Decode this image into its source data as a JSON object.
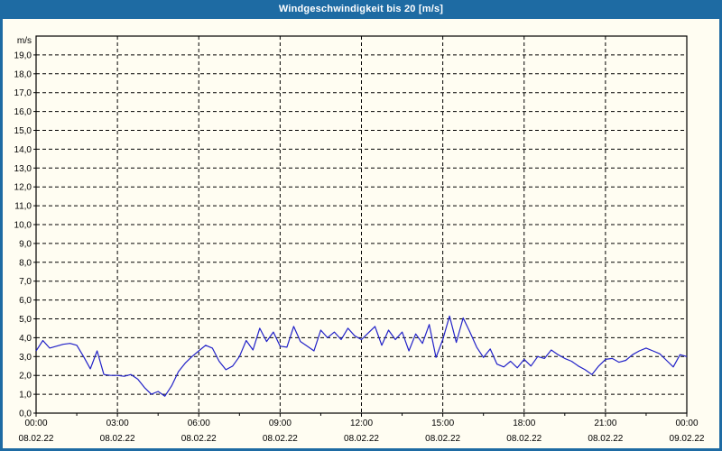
{
  "window": {
    "title": "Windgeschwindigkeit bis 20 [m/s]"
  },
  "colors": {
    "titlebar_bg": "#1e6ba3",
    "frame_border": "#1e6ba3",
    "content_bg": "#fffdf2",
    "plot_bg": "#fffdf2",
    "grid": "#000000",
    "axis": "#000000",
    "tick_text": "#000000",
    "title_text": "#ffffff",
    "line": "#2121c8"
  },
  "chart_data": {
    "type": "line",
    "title": "Windgeschwindigkeit bis 20 [m/s]",
    "xlabel": "",
    "ylabel": "m/s",
    "ylim": [
      0,
      20
    ],
    "y_tick_step": 1.0,
    "y_tick_labels": [
      "0,0",
      "1,0",
      "2,0",
      "3,0",
      "4,0",
      "5,0",
      "6,0",
      "7,0",
      "8,0",
      "9,0",
      "10,0",
      "11,0",
      "12,0",
      "13,0",
      "14,0",
      "15,0",
      "16,0",
      "17,0",
      "18,0",
      "19,0"
    ],
    "x_range_hours": [
      0,
      24
    ],
    "x_step_hours": 0.25,
    "x_major_ticks": [
      {
        "hour": 0,
        "time": "00:00",
        "date": "08.02.22"
      },
      {
        "hour": 3,
        "time": "03:00",
        "date": "08.02.22"
      },
      {
        "hour": 6,
        "time": "06:00",
        "date": "08.02.22"
      },
      {
        "hour": 9,
        "time": "09:00",
        "date": "08.02.22"
      },
      {
        "hour": 12,
        "time": "12:00",
        "date": "08.02.22"
      },
      {
        "hour": 15,
        "time": "15:00",
        "date": "08.02.22"
      },
      {
        "hour": 18,
        "time": "18:00",
        "date": "08.02.22"
      },
      {
        "hour": 21,
        "time": "21:00",
        "date": "08.02.22"
      },
      {
        "hour": 24,
        "time": "00:00",
        "date": "09.02.22"
      }
    ],
    "x_minor_tick_hours": [
      1.5,
      4.5,
      7.5,
      10.5,
      13.5,
      16.5,
      19.5,
      22.5
    ],
    "grid": "dashed",
    "legend": "none",
    "series": [
      {
        "name": "Windgeschwindigkeit",
        "unit": "m/s",
        "values": [
          3.3,
          3.85,
          3.45,
          3.55,
          3.65,
          3.7,
          3.6,
          3.0,
          2.35,
          3.3,
          2.05,
          2.0,
          2.0,
          1.95,
          2.05,
          1.8,
          1.35,
          1.0,
          1.15,
          0.9,
          1.45,
          2.2,
          2.65,
          3.0,
          3.3,
          3.6,
          3.45,
          2.75,
          2.3,
          2.5,
          3.0,
          3.85,
          3.35,
          4.5,
          3.8,
          4.3,
          3.55,
          3.5,
          4.6,
          3.8,
          3.55,
          3.3,
          4.4,
          4.0,
          4.3,
          3.9,
          4.5,
          4.1,
          3.9,
          4.25,
          4.6,
          3.6,
          4.4,
          3.9,
          4.3,
          3.3,
          4.2,
          3.7,
          4.7,
          2.95,
          3.9,
          5.15,
          3.75,
          5.05,
          4.3,
          3.5,
          2.95,
          3.4,
          2.6,
          2.45,
          2.75,
          2.4,
          2.85,
          2.5,
          3.0,
          2.9,
          3.35,
          3.1,
          2.9,
          2.75,
          2.5,
          2.3,
          2.05,
          2.5,
          2.85,
          2.9,
          2.7,
          2.8,
          3.1,
          3.3,
          3.45,
          3.3,
          3.15,
          2.8,
          2.45,
          3.1,
          3.0
        ]
      }
    ]
  }
}
